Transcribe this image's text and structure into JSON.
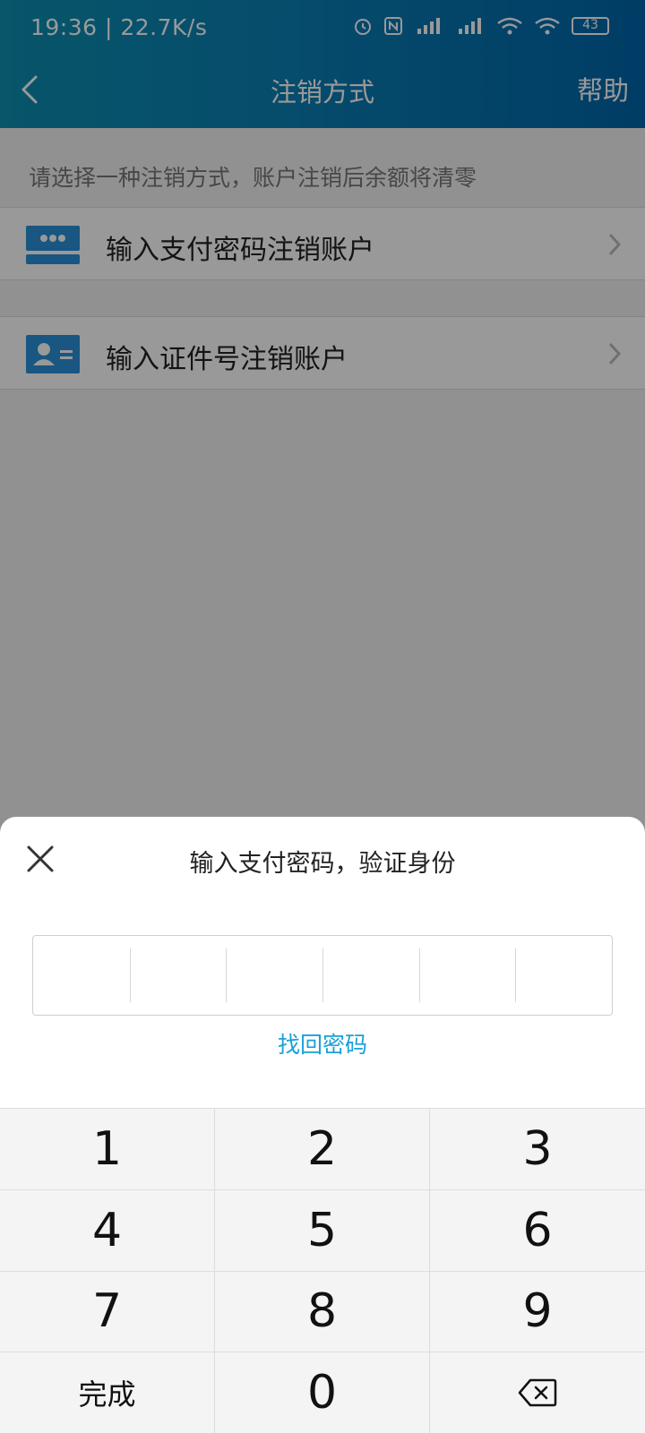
{
  "status_bar": {
    "time": "19:36 | 22.7K/s",
    "battery": "43",
    "icons": [
      "alarm-icon",
      "nfc-icon",
      "hd-signal-icon",
      "hd-signal-icon",
      "wifi-icon",
      "wifi-icon",
      "battery-icon"
    ]
  },
  "header": {
    "title": "注销方式",
    "help": "帮助"
  },
  "content": {
    "hint": "请选择一种注销方式，账户注销后余额将清零",
    "options": [
      {
        "label": "输入支付密码注销账户",
        "icon": "password-card-icon"
      },
      {
        "label": "输入证件号注销账户",
        "icon": "id-card-icon"
      }
    ]
  },
  "sheet": {
    "title": "输入支付密码，验证身份",
    "forgot": "找回密码",
    "password_cells": 6
  },
  "keypad": {
    "keys": [
      "1",
      "2",
      "3",
      "4",
      "5",
      "6",
      "7",
      "8",
      "9",
      "完成",
      "0",
      ""
    ]
  },
  "colors": {
    "header_gradient_start": "#0c8fb0",
    "header_gradient_end": "#0166aa",
    "link": "#1aa0d8",
    "icon_blue": "#2a8fd8"
  }
}
